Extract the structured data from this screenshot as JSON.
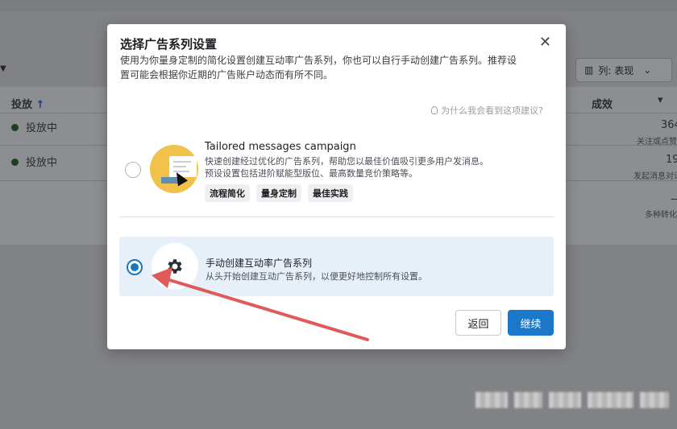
{
  "background": {
    "column_selector_label": "列: 表现",
    "header_delivery": "投放",
    "header_results": "成效",
    "rows": [
      {
        "status": "投放中",
        "value": "364",
        "sub": "关注或点赞"
      },
      {
        "status": "投放中",
        "value": "19",
        "sub": "发起消息对话"
      },
      {
        "status": "",
        "value": "—",
        "sub": "多种转化"
      }
    ]
  },
  "modal": {
    "title": "选择广告系列设置",
    "description": "使用为你量身定制的简化设置创建互动率广告系列，你也可以自行手动创建广告系列。推荐设置可能会根据你近期的广告账户动态而有所不同。",
    "hint": "为什么我会看到这项建议?",
    "options": [
      {
        "title": "Tailored messages campaign",
        "description_line1": "快速创建经过优化的广告系列，帮助您以最佳价值吸引更多用户发消息。",
        "description_line2": "预设设置包括进阶赋能型版位、最高数量竞价策略等。",
        "tags": [
          "流程简化",
          "量身定制",
          "最佳实践"
        ],
        "selected": false
      },
      {
        "title": "手动创建互动率广告系列",
        "description": "从头开始创建互动广告系列，以便更好地控制所有设置。",
        "selected": true
      }
    ],
    "back_label": "返回",
    "continue_label": "继续"
  },
  "colors": {
    "primary": "#1a77c9",
    "selected_bg": "#e7f0f8",
    "annotation_arrow": "#e05a5a"
  }
}
